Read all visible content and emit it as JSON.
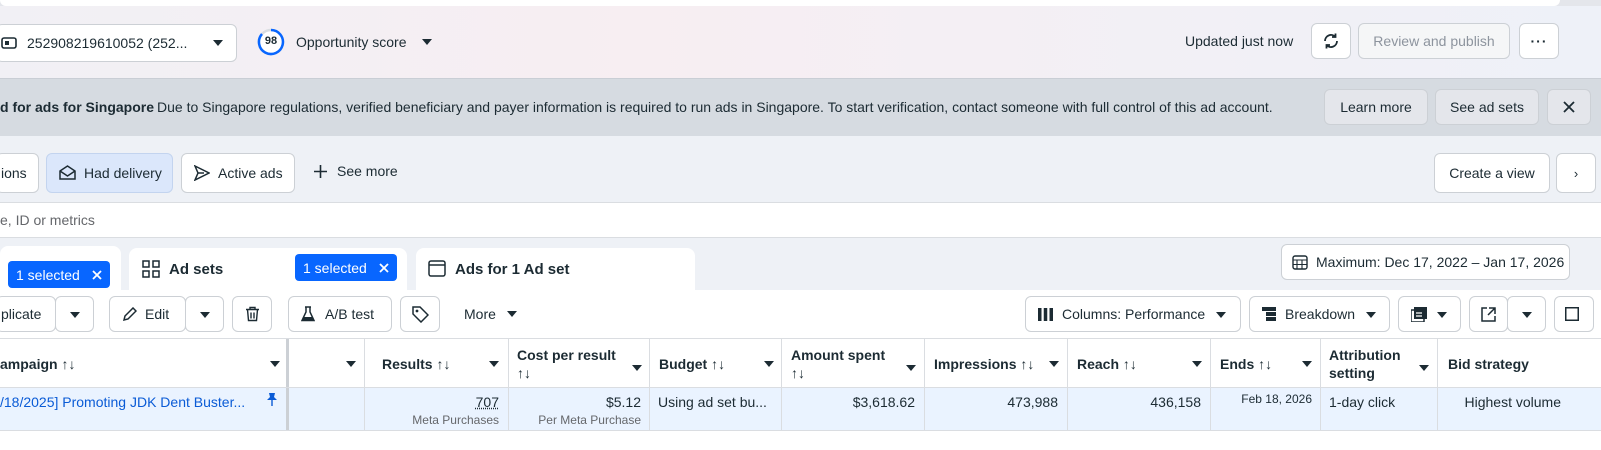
{
  "topbar": {
    "account_label": "252908219610052 (252...",
    "score_value": "98",
    "score_label": "Opportunity score",
    "updated_text": "Updated just now",
    "review_publish_label": "Review and publish"
  },
  "banner": {
    "title": "d for ads for Singapore",
    "message": "Due to Singapore regulations, verified beneficiary and payer information is required to run ads in Singapore. To start verification, contact someone with full control of this ad account.",
    "learn_more_label": "Learn more",
    "see_ad_sets_label": "See ad sets"
  },
  "filters": {
    "partial_label": "ions",
    "had_delivery_label": "Had delivery",
    "active_ads_label": "Active ads",
    "see_more_label": "See more",
    "create_view_label": "Create a view"
  },
  "search": {
    "placeholder_visible": "e, ID or metrics"
  },
  "tabs": {
    "campaigns_selected": "1 selected",
    "ad_sets_label": "Ad sets",
    "ad_sets_selected": "1 selected",
    "ads_label": "Ads for 1 Ad set",
    "date_range": "Maximum: Dec 17, 2022 – Jan 17, 2026"
  },
  "toolbar": {
    "duplicate_partial": "plicate",
    "edit_label": "Edit",
    "ab_test_label": "A/B test",
    "more_label": "More",
    "columns_label": "Columns: Performance",
    "breakdown_label": "Breakdown"
  },
  "table": {
    "headers": {
      "campaign": "ampaign ↑↓",
      "results": "Results ↑↓",
      "cost_per_result_1": "Cost per result",
      "cost_per_result_2": "↑↓",
      "budget": "Budget ↑↓",
      "amount_spent_1": "Amount spent",
      "amount_spent_2": "↑↓",
      "impressions": "Impressions ↑↓",
      "reach": "Reach ↑↓",
      "ends": "Ends ↑↓",
      "attribution_1": "Attribution",
      "attribution_2": "setting",
      "bid_strategy": "Bid strategy"
    },
    "row": {
      "campaign_name": "/18/2025] Promoting JDK Dent Buster...",
      "results": "707",
      "results_sub": "Meta Purchases",
      "cost_per_result": "$5.12",
      "cost_sub": "Per Meta Purchase",
      "budget": "Using ad set bu...",
      "amount_spent": "$3,618.62",
      "impressions": "473,988",
      "reach": "436,158",
      "ends": "Feb 18, 2026",
      "attribution": "1-day click",
      "bid_strategy": "Highest volume"
    }
  },
  "colors": {
    "accent": "#0866ff",
    "link": "#0a5bd6",
    "selected_tab": "#dbe7fb"
  }
}
